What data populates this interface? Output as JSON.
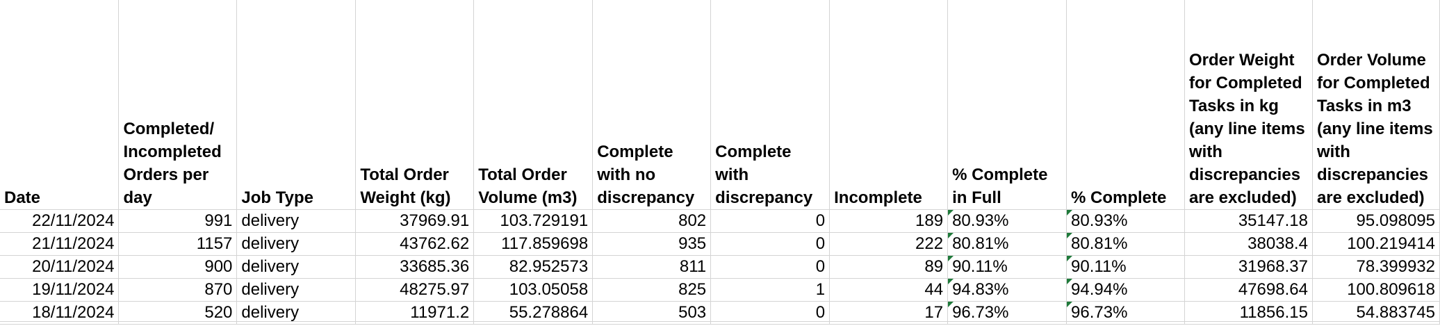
{
  "headers": [
    "Date",
    "Completed/ Incompleted Orders per day",
    "Job Type",
    "Total Order Weight (kg)",
    "Total Order Volume (m3)",
    "Complete with no discrepancy",
    "Complete with discrepancy",
    "Incomplete",
    "% Complete in Full",
    "% Complete",
    "Order Weight for Completed Tasks in kg (any line items with discrepancies are excluded)",
    "Order Volume for Completed Tasks in m3 (any line items with discrepancies are excluded)"
  ],
  "rows": [
    [
      "22/11/2024",
      "991",
      "delivery",
      "37969.91",
      "103.729191",
      "802",
      "0",
      "189",
      "80.93%",
      "80.93%",
      "35147.18",
      "95.098095"
    ],
    [
      "21/11/2024",
      "1157",
      "delivery",
      "43762.62",
      "117.859698",
      "935",
      "0",
      "222",
      "80.81%",
      "80.81%",
      "38038.4",
      "100.219414"
    ],
    [
      "20/11/2024",
      "900",
      "delivery",
      "33685.36",
      "82.952573",
      "811",
      "0",
      "89",
      "90.11%",
      "90.11%",
      "31968.37",
      "78.399932"
    ],
    [
      "19/11/2024",
      "870",
      "delivery",
      "48275.97",
      "103.05058",
      "825",
      "1",
      "44",
      "94.83%",
      "94.94%",
      "47698.64",
      "100.809618"
    ],
    [
      "18/11/2024",
      "520",
      "delivery",
      "11971.2",
      "55.278864",
      "503",
      "0",
      "17",
      "96.73%",
      "96.73%",
      "11856.15",
      "54.883745"
    ]
  ],
  "colors": {
    "gridline": "#d4d4d4",
    "error_flag": "#1f7a3a"
  }
}
